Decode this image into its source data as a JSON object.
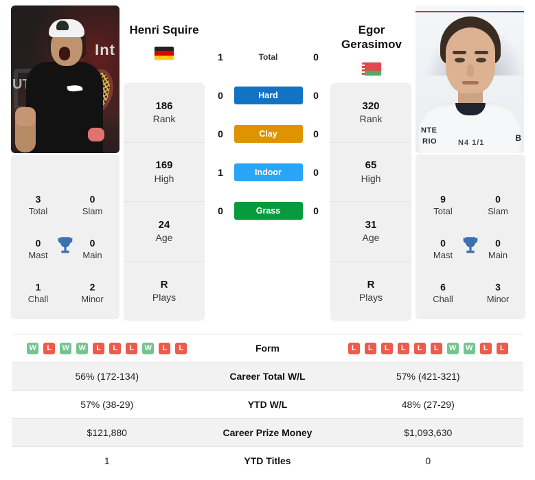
{
  "players": {
    "left": {
      "name": "Henri Squire",
      "name_under_photo": "Henri Squire",
      "country": "Germany",
      "flag": "de-flag",
      "stats": [
        {
          "value": "186",
          "label": "Rank"
        },
        {
          "value": "169",
          "label": "High"
        },
        {
          "value": "24",
          "label": "Age"
        },
        {
          "value": "R",
          "label": "Plays"
        }
      ],
      "titles": [
        {
          "value": "3",
          "label": "Total"
        },
        {
          "value": "0",
          "label": "Slam"
        },
        {
          "value": "0",
          "label": "Mast"
        },
        {
          "value": "0",
          "label": "Main"
        },
        {
          "value": "1",
          "label": "Chall"
        },
        {
          "value": "2",
          "label": "Minor"
        }
      ],
      "form": [
        "W",
        "L",
        "W",
        "W",
        "L",
        "L",
        "L",
        "W",
        "L",
        "L"
      ],
      "career_total_wl": "56% (172-134)",
      "ytd_wl": "57% (38-29)",
      "career_prize_money": "$121,880",
      "ytd_titles": "1"
    },
    "right": {
      "name": "Egor Gerasimov",
      "name_under_photo": "Egor Gerasimov",
      "country": "Belarus",
      "flag": "by-flag",
      "stats": [
        {
          "value": "320",
          "label": "Rank"
        },
        {
          "value": "65",
          "label": "High"
        },
        {
          "value": "31",
          "label": "Age"
        },
        {
          "value": "R",
          "label": "Plays"
        }
      ],
      "titles": [
        {
          "value": "9",
          "label": "Total"
        },
        {
          "value": "0",
          "label": "Slam"
        },
        {
          "value": "0",
          "label": "Mast"
        },
        {
          "value": "0",
          "label": "Main"
        },
        {
          "value": "6",
          "label": "Chall"
        },
        {
          "value": "3",
          "label": "Minor"
        }
      ],
      "form": [
        "L",
        "L",
        "L",
        "L",
        "L",
        "L",
        "W",
        "W",
        "L",
        "L"
      ],
      "career_total_wl": "57% (421-321)",
      "ytd_wl": "48% (27-29)",
      "career_prize_money": "$1,093,630",
      "ytd_titles": "0"
    }
  },
  "head_to_head": [
    {
      "label": "Total",
      "left": "1",
      "right": "0",
      "type": "text",
      "color": ""
    },
    {
      "label": "Hard",
      "left": "0",
      "right": "0",
      "type": "surface",
      "color": "#1273c4"
    },
    {
      "label": "Clay",
      "left": "0",
      "right": "0",
      "type": "surface",
      "color": "#e09300"
    },
    {
      "label": "Indoor",
      "left": "1",
      "right": "0",
      "type": "surface",
      "color": "#29a4f7"
    },
    {
      "label": "Grass",
      "left": "0",
      "right": "0",
      "type": "surface",
      "color": "#069c3e"
    }
  ],
  "table": {
    "rows": [
      {
        "label": "Form",
        "key": "form",
        "type": "form"
      },
      {
        "label": "Career Total W/L",
        "key": "career_total_wl",
        "type": "text"
      },
      {
        "label": "YTD W/L",
        "key": "ytd_wl",
        "type": "text"
      },
      {
        "label": "Career Prize Money",
        "key": "career_prize_money",
        "type": "text"
      },
      {
        "label": "YTD Titles",
        "key": "ytd_titles",
        "type": "text"
      }
    ]
  },
  "colors": {
    "hard": "#1273c4",
    "clay": "#e09300",
    "indoor": "#29a4f7",
    "grass": "#069c3e",
    "win_badge": "#74c490",
    "loss_badge": "#ef5a4a",
    "card_bg": "#f0f0f0",
    "row_shade": "#f2f2f2"
  },
  "photo_text": {
    "left_banner": "Int",
    "left_banner2": "UT",
    "right_shirt_1": "NTE",
    "right_shirt_2": "RIO",
    "right_shirt_3": "N4 1/1",
    "right_shirt_4": "B"
  }
}
